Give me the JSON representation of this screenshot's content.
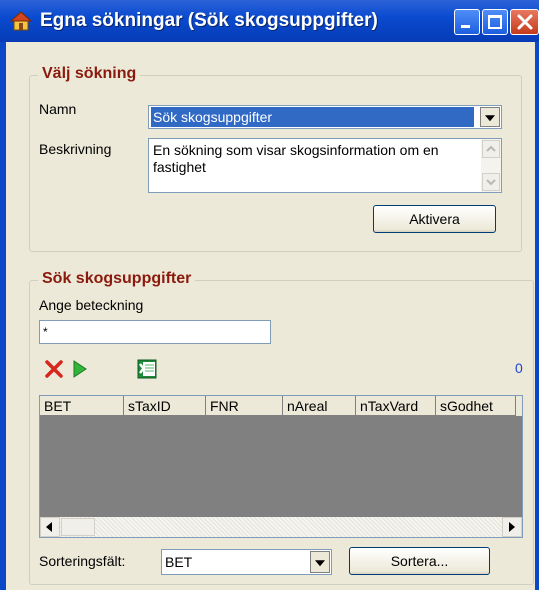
{
  "window": {
    "title": "Egna sökningar (Sök skogsuppgifter)",
    "icons": {
      "app": "house-icon",
      "minimize": "minimize-icon",
      "maximize": "maximize-icon",
      "close": "close-icon"
    }
  },
  "valj_sokning": {
    "legend": "Välj sökning",
    "namn_label": "Namn",
    "namn_value": "Sök skogsuppgifter",
    "beskrivning_label": "Beskrivning",
    "beskrivning_value": "En sökning som visar skogsinformation om en fastighet",
    "aktivera_label": "Aktivera"
  },
  "sok_skogsuppgifter": {
    "legend": "Sök skogsuppgifter",
    "ange_label": "Ange beteckning",
    "ange_value": "*",
    "toolbar": {
      "clear_icon": "red-x-icon",
      "run_icon": "green-play-icon",
      "excel_icon": "excel-icon"
    },
    "count": "0",
    "columns": [
      "BET",
      "sTaxID",
      "FNR",
      "nAreal",
      "nTaxVard",
      "sGodhet"
    ],
    "sort_label": "Sorteringsfält:",
    "sort_value": "BET",
    "sortera_label": "Sortera..."
  },
  "colors": {
    "titlebar": "#0a4bd0",
    "group_title": "#8b1a0e",
    "count": "#1e44d4",
    "grid_bg": "#808080",
    "selection": "#316ac5"
  }
}
